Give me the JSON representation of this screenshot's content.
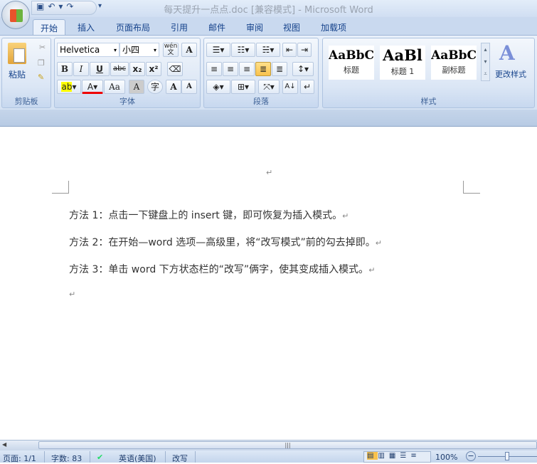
{
  "window": {
    "title": "每天提升一点点.doc [兼容模式] - Microsoft Word"
  },
  "qat": {
    "save": "save-icon",
    "undo": "undo-icon",
    "redo": "redo-icon",
    "customize": "▾"
  },
  "tabs": [
    "开始",
    "插入",
    "页面布局",
    "引用",
    "邮件",
    "审阅",
    "视图",
    "加载项"
  ],
  "ribbon": {
    "clipboard": {
      "paste": "粘贴",
      "label": "剪贴板"
    },
    "font": {
      "name": "Helvetica",
      "size": "小四",
      "bold": "B",
      "italic": "I",
      "underline": "U",
      "strike": "abc",
      "sub": "x₂",
      "sup": "x²",
      "change_case": "Aa",
      "grow": "A",
      "shrink": "A",
      "char_shading": "A",
      "enclose": "字",
      "phonetic": "wén 文",
      "border": "A",
      "label": "字体"
    },
    "paragraph": {
      "label": "段落"
    },
    "styles": {
      "items": [
        {
          "preview": "AaBbC",
          "name": "标题"
        },
        {
          "preview": "AaBl",
          "name": "标题 1"
        },
        {
          "preview": "AaBbC",
          "name": "副标题"
        }
      ],
      "change": "更改样式",
      "label": "样式"
    }
  },
  "document": {
    "paragraphs": [
      "方法 1：点击一下键盘上的 insert 键，即可恢复为插入模式。",
      "方法 2：在开始—word 选项—高级里，将“改写模式”前的勾去掉即。",
      "方法 3：单击 word 下方状态栏的“改写”俩字，使其变成插入模式。",
      ""
    ],
    "mark": "↵"
  },
  "status": {
    "page": "页面: 1/1",
    "words": "字数: 83",
    "language": "英语(美国)",
    "mode": "改写",
    "zoom": "100%"
  },
  "colors": {
    "accent": "#15428b",
    "ribbon": "#dbe6f5"
  }
}
